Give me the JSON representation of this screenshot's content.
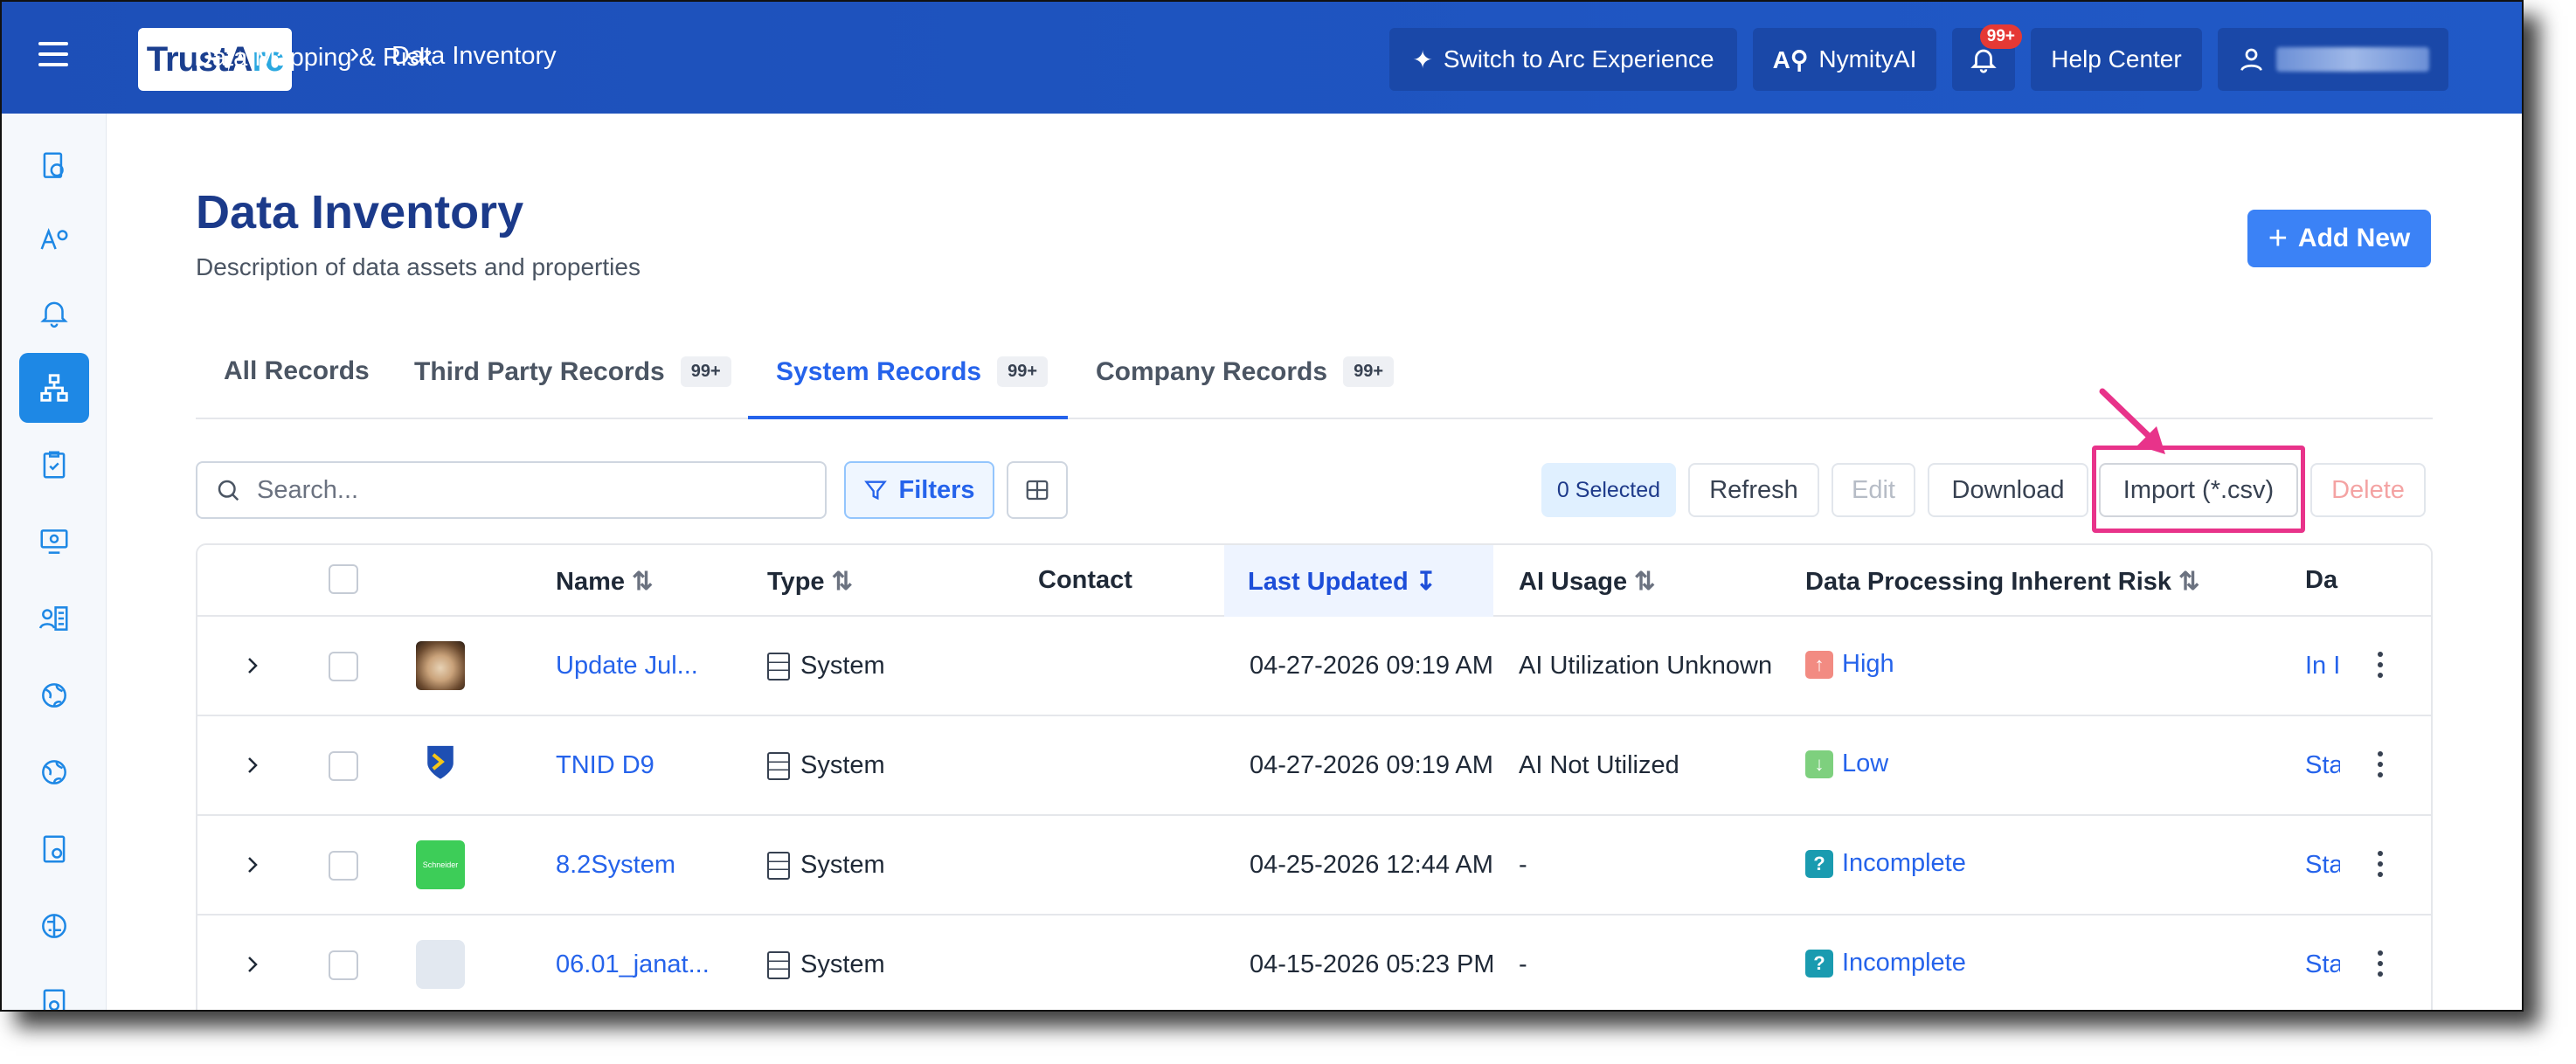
{
  "header": {
    "logo_text": "TrustArc",
    "logo_prefix": "TrustA",
    "logo_suffix": "rc",
    "breadcrumb": [
      "Data Mapping & Risk",
      "Data Inventory"
    ],
    "switch_label": "Switch to Arc Experience",
    "nymity_label": "NymityAI",
    "notifications_count": "99+",
    "help_label": "Help Center",
    "user_name_redacted": true
  },
  "sidebar": {
    "items": [
      "dashboard-icon",
      "ai-icon",
      "bell-icon",
      "data-map-icon",
      "clipboard-check-icon",
      "presentation-icon",
      "people-list-icon",
      "globe-icon",
      "globe-icon",
      "document-settings-icon",
      "brain-icon",
      "document-icon"
    ],
    "active_index": 3
  },
  "page": {
    "title": "Data Inventory",
    "subtitle": "Description of data assets and properties",
    "add_new_label": "Add New"
  },
  "tabs": [
    {
      "label": "All Records",
      "count": ""
    },
    {
      "label": "Third Party Records",
      "count": "99+"
    },
    {
      "label": "System Records",
      "count": "99+"
    },
    {
      "label": "Company Records",
      "count": "99+"
    }
  ],
  "active_tab": 2,
  "toolbar": {
    "search_placeholder": "Search...",
    "filters_label": "Filters",
    "selected_label": "0 Selected",
    "refresh_label": "Refresh",
    "edit_label": "Edit",
    "download_label": "Download",
    "import_label": "Import (*.csv)",
    "delete_label": "Delete"
  },
  "table": {
    "columns": [
      "Name",
      "Type",
      "Contact",
      "Last Updated",
      "AI Usage",
      "Data Processing Inherent Risk",
      "Da"
    ],
    "sorted_column": "Last Updated",
    "rows": [
      {
        "name": "Update Jul...",
        "type": "System",
        "contact": "",
        "last_updated": "04-27-2026 09:19 AM",
        "ai_usage": "AI Utilization Unknown",
        "risk": "High",
        "status": "In I",
        "logo": "cat-photo"
      },
      {
        "name": "TNID D9",
        "type": "System",
        "contact": "",
        "last_updated": "04-27-2026 09:19 AM",
        "ai_usage": "AI Not Utilized",
        "risk": "Low",
        "status": "Sta",
        "logo": "shield-logo"
      },
      {
        "name": "8.2System",
        "type": "System",
        "contact": "",
        "last_updated": "04-25-2026 12:44 AM",
        "ai_usage": "-",
        "risk": "Incomplete",
        "status": "Sta",
        "logo": "schneider-logo",
        "logo_text": "Schneider"
      },
      {
        "name": "06.01_janat...",
        "type": "System",
        "contact": "",
        "last_updated": "04-15-2026 05:23 PM",
        "ai_usage": "-",
        "risk": "Incomplete",
        "status": "Sta",
        "logo": "blank-logo"
      }
    ]
  },
  "colors": {
    "topbar": "#1d4fb8",
    "accent": "#2563eb",
    "highlight": "#e8338a",
    "risk_high": "#f28b82",
    "risk_low": "#7ed07e",
    "risk_incomplete": "#1a9bb0"
  }
}
